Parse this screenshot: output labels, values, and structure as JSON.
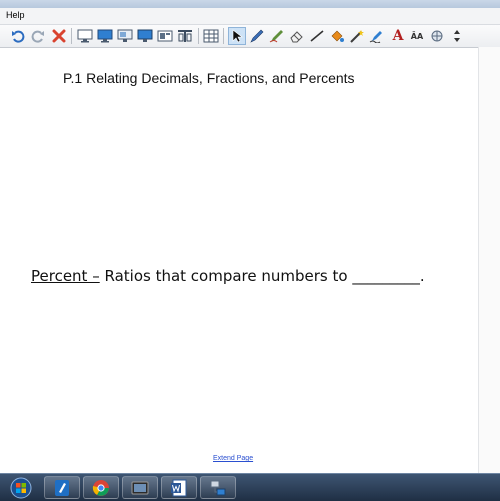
{
  "menu": {
    "help_label": "Help"
  },
  "toolbar": {
    "items": [
      {
        "icon": "undo-icon"
      },
      {
        "icon": "redo-icon"
      },
      {
        "icon": "delete-icon"
      },
      {
        "icon": "screen-shade-icon"
      },
      {
        "icon": "show-desktop-icon"
      },
      {
        "icon": "display-icon"
      },
      {
        "icon": "monitor-icon"
      },
      {
        "icon": "capture-icon"
      },
      {
        "icon": "page-layout-icon"
      },
      {
        "icon": "table-icon"
      },
      {
        "icon": "select-pointer-icon"
      },
      {
        "icon": "pen-icon"
      },
      {
        "icon": "creative-pen-icon"
      },
      {
        "icon": "eraser-icon"
      },
      {
        "icon": "line-icon"
      },
      {
        "icon": "fill-icon"
      },
      {
        "icon": "magic-pen-icon"
      },
      {
        "icon": "handwriting-icon"
      },
      {
        "icon": "text-icon"
      },
      {
        "icon": "text-format-icon"
      },
      {
        "icon": "properties-icon"
      },
      {
        "icon": "move-toolbar-icon"
      }
    ],
    "text_tool_label": "A",
    "text_format_label": "ĀA"
  },
  "page": {
    "title": "P.1 Relating Decimals, Fractions, and Percents",
    "percent_term": "Percent –",
    "percent_definition": " Ratios that compare numbers to _________.",
    "extend_page_label": "Extend Page"
  },
  "taskbar": {
    "start_icon": "windows-start-icon",
    "apps": [
      {
        "icon": "notebook-app-icon"
      },
      {
        "icon": "chrome-browser-icon"
      },
      {
        "icon": "video-app-icon"
      },
      {
        "icon": "word-app-icon"
      },
      {
        "icon": "network-app-icon"
      }
    ]
  },
  "colors": {
    "link": "#2a4fd0",
    "taskbar": "#1f2f44",
    "accent_red": "#d9432f",
    "accent_blue": "#1f6fc4"
  }
}
